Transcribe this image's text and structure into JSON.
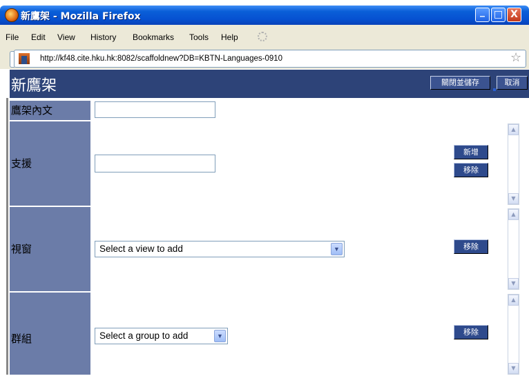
{
  "window": {
    "title_app": "新鷹架",
    "title_browser": "- Mozilla Firefox",
    "minimize": "_",
    "maximize": "□",
    "close": "X"
  },
  "menu": {
    "file": "File",
    "edit": "Edit",
    "view": "View",
    "history": "History",
    "bookmarks": "Bookmarks",
    "tools": "Tools",
    "help": "Help"
  },
  "address": {
    "url": "http://kf48.cite.hku.hk:8082/scaffoldnew?DB=KBTN-Languages-0910"
  },
  "app": {
    "title": "新鷹架",
    "close_save_button": "關閉並儲存",
    "cancel_button": "取消"
  },
  "form": {
    "content_label": "鷹架內文",
    "content_value": "",
    "support_label": "支援",
    "support_value": "",
    "add_button": "新增",
    "remove_button_support": "移除",
    "view_label": "視窗",
    "view_select": "Select a view to add",
    "remove_button_view": "移除",
    "group_label": "群組",
    "group_select": "Select a group to add",
    "remove_button_group": "移除"
  },
  "colors": {
    "titlebar": "#0a5fd8",
    "app_header": "#2d4378",
    "label_cell": "#6b7ca8",
    "button": "#2e4a8c"
  }
}
